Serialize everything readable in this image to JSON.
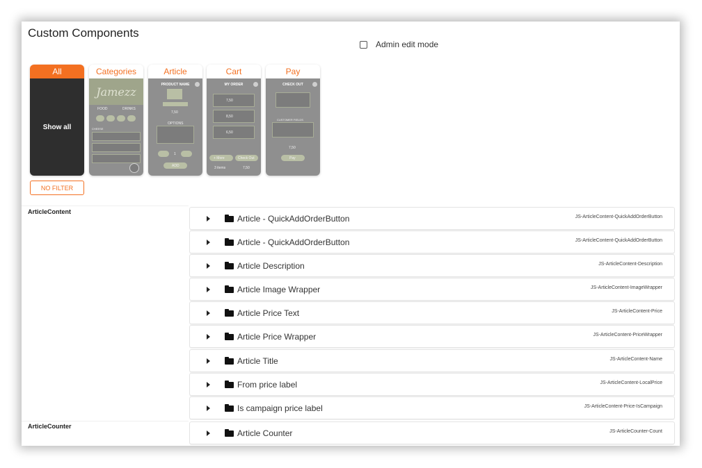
{
  "page_title": "Custom Components",
  "admin": {
    "label": "Admin edit mode",
    "checked": false
  },
  "cards": [
    {
      "label": "All",
      "active": true,
      "body_text": "Show all"
    },
    {
      "label": "Categories",
      "brand": "Jamezz",
      "tabs": [
        "FOOD",
        "DRINKS"
      ],
      "section": "CHEESE"
    },
    {
      "label": "Article",
      "title": "PRODUCT NAME",
      "price": "7,50",
      "options": "OPTIONS",
      "qty": "1",
      "add": "ADD"
    },
    {
      "label": "Cart",
      "title": "MY ORDER",
      "items": [
        "7,50",
        "8,50",
        "6,50"
      ],
      "more": "+ More",
      "checkout": "Check Out",
      "count": "3 items",
      "total": "7,50"
    },
    {
      "label": "Pay",
      "title": "CHECK OUT",
      "section": "CUSTOMER FIELDS",
      "total": "7,50",
      "pay": "Pay"
    }
  ],
  "filter_button": "NO FILTER",
  "groups": [
    {
      "name": "ArticleContent",
      "rows": [
        {
          "name": "Article - QuickAddOrderButton",
          "id": "JS-ArticleContent-QuickAddOrderButton"
        },
        {
          "name": "Article - QuickAddOrderButton",
          "id": "JS-ArticleContent-QuickAddOrderButton"
        },
        {
          "name": "Article Description",
          "id": "JS-ArticleContent-Description"
        },
        {
          "name": "Article Image Wrapper",
          "id": "JS-ArticleContent-ImageWrapper"
        },
        {
          "name": "Article Price Text",
          "id": "JS-ArticleContent-Price"
        },
        {
          "name": "Article Price Wrapper",
          "id": "JS-ArticleContent-PriceWrapper"
        },
        {
          "name": "Article Title",
          "id": "JS-ArticleContent-Name"
        },
        {
          "name": "From price label",
          "id": "JS-ArticleContent-LocalPrice"
        },
        {
          "name": "Is campaign price label",
          "id": "JS-ArticleContent-Price-IsCampaign"
        }
      ]
    },
    {
      "name": "ArticleCounter",
      "rows": [
        {
          "name": "Article Counter",
          "id": "JS-ArticleCounter-Count"
        }
      ]
    }
  ],
  "icons": {
    "expand": "caret-right-icon",
    "folder": "folder-icon"
  },
  "colors": {
    "accent": "#f37021",
    "card_dark": "#2e2e2e",
    "card_gray": "#8f8f8f"
  }
}
